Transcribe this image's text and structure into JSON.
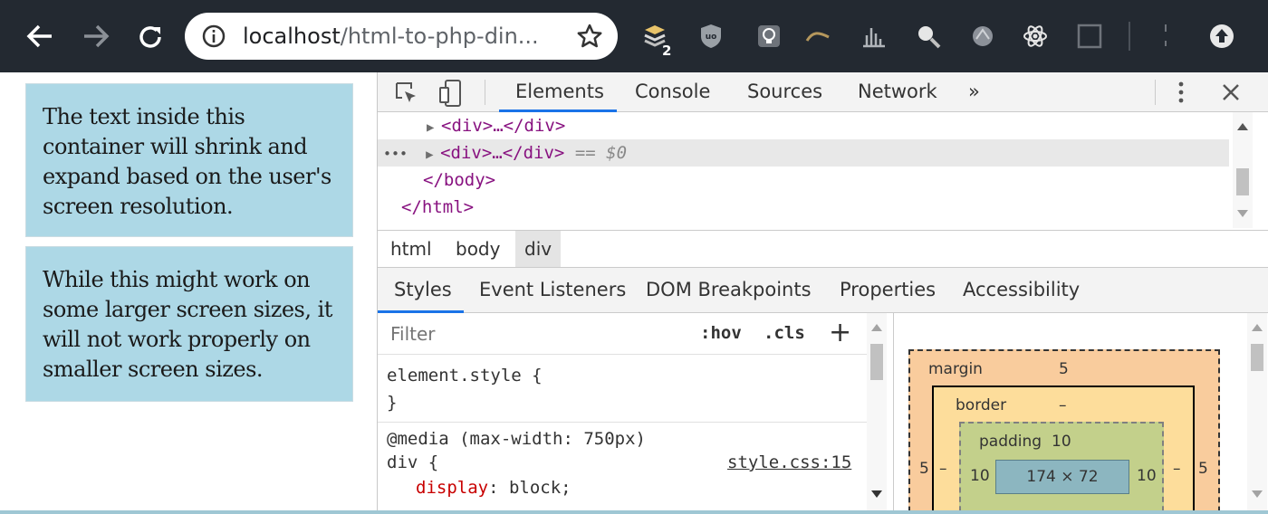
{
  "browser": {
    "url_host": "localhost",
    "url_path": "/html-to-php-din...",
    "extension_badge": "2"
  },
  "page": {
    "box1_text": "The text inside this container will shrink and expand based on the user's screen resolution.",
    "box2_text": "While this might work on some larger screen sizes, it will not work properly on smaller screen sizes."
  },
  "devtools": {
    "tabs": [
      "Elements",
      "Console",
      "Sources",
      "Network"
    ],
    "more_tabs": "»",
    "dom": {
      "line1": "<div>…</div>",
      "line2": "<div>…</div>",
      "line2_suffix": "== $0",
      "line2_dots": "•••",
      "line3": "</body>",
      "line4": "</html>"
    },
    "breadcrumbs": [
      "html",
      "body",
      "div"
    ],
    "sub_tabs": [
      "Styles",
      "Event Listeners",
      "DOM Breakpoints",
      "Properties",
      "Accessibility"
    ],
    "styles": {
      "filter_placeholder": "Filter",
      "hov": ":hov",
      "cls": ".cls",
      "plus": "+",
      "element_style_open": "element.style {",
      "element_style_close": "}",
      "media_query": "@media (max-width: 750px)",
      "selector": "div {",
      "source_link": "style.css:15",
      "prop_name": "display",
      "prop_value": ": block;"
    },
    "box_model": {
      "margin_label": "margin",
      "margin_top": "5",
      "margin_left": "5",
      "margin_right": "5",
      "border_label": "border",
      "border_top": "–",
      "border_left": "–",
      "border_right": "–",
      "padding_label": "padding",
      "padding_top": "10",
      "padding_left": "10",
      "padding_right": "10",
      "content_size": "174 × 72"
    }
  }
}
